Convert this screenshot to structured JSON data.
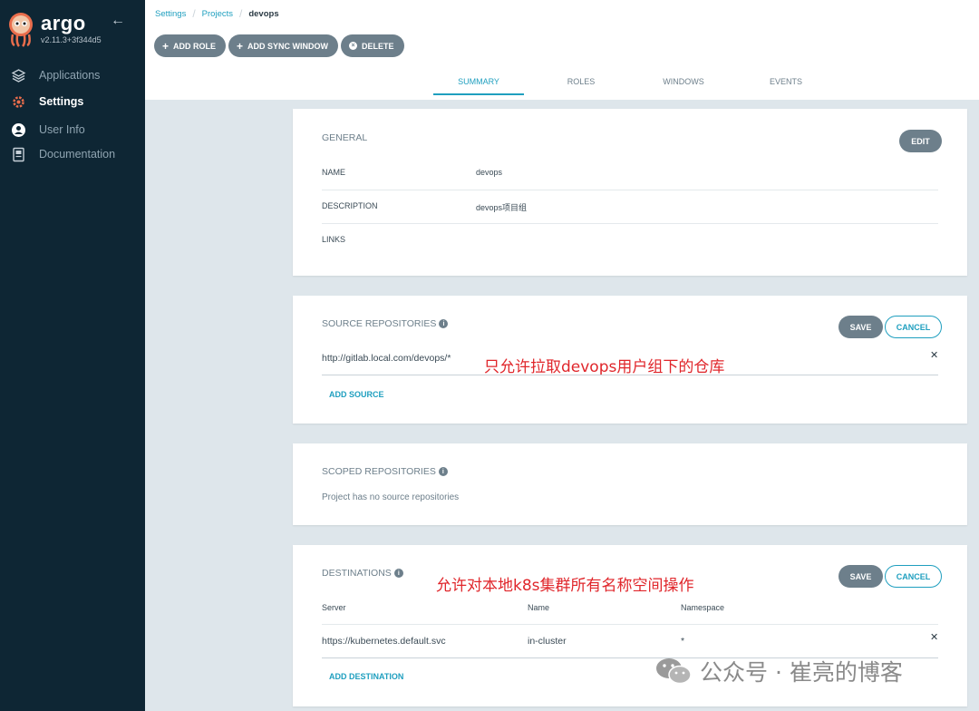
{
  "sidebar": {
    "brand": "argo",
    "version": "v2.11.3+3f344d5",
    "items": [
      {
        "label": "Applications"
      },
      {
        "label": "Settings"
      },
      {
        "label": "User Info"
      },
      {
        "label": "Documentation"
      }
    ]
  },
  "breadcrumb": [
    "Settings",
    "Projects",
    "devops"
  ],
  "toolbar": {
    "add_role": "ADD ROLE",
    "add_sync_window": "ADD SYNC WINDOW",
    "delete": "DELETE"
  },
  "tabs": [
    "SUMMARY",
    "ROLES",
    "WINDOWS",
    "EVENTS"
  ],
  "general": {
    "title": "GENERAL",
    "edit": "EDIT",
    "rows": [
      {
        "label": "NAME",
        "value": "devops"
      },
      {
        "label": "DESCRIPTION",
        "value": "devops项目组"
      },
      {
        "label": "LINKS",
        "value": ""
      }
    ]
  },
  "source_repos": {
    "title": "SOURCE REPOSITORIES",
    "save": "SAVE",
    "cancel": "CANCEL",
    "repo": "http://gitlab.local.com/devops/*",
    "annotation": "只允许拉取devops用户组下的仓库",
    "add": "ADD SOURCE"
  },
  "scoped_repos": {
    "title": "SCOPED REPOSITORIES",
    "empty": "Project has no source repositories"
  },
  "destinations": {
    "title": "DESTINATIONS",
    "annotation": "允许对本地k8s集群所有名称空间操作",
    "save": "SAVE",
    "cancel": "CANCEL",
    "columns": [
      "Server",
      "Name",
      "Namespace"
    ],
    "row": {
      "server": "https://kubernetes.default.svc",
      "name": "in-cluster",
      "namespace": "*"
    },
    "add": "ADD DESTINATION"
  },
  "watermark": "公众号 · 崔亮的博客",
  "colors": {
    "sidebar": "#0e2634",
    "accent": "#1f9fbf",
    "button": "#6d7f8b",
    "annotation": "#e0262b"
  }
}
